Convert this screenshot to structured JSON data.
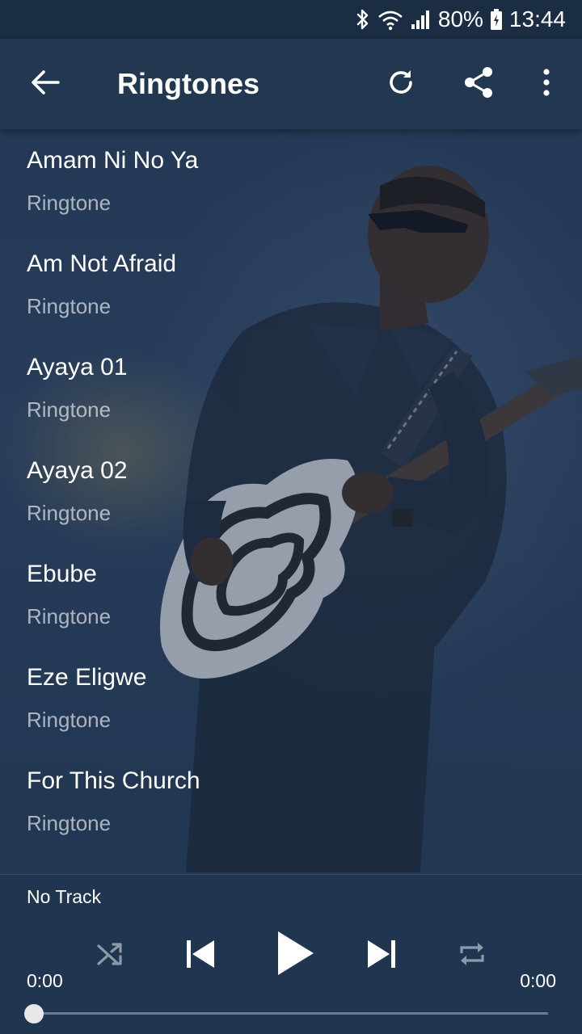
{
  "status_bar": {
    "battery_percent": "80%",
    "time": "13:44",
    "icons": [
      "bluetooth-icon",
      "wifi-icon",
      "signal-icon",
      "battery-charging-icon"
    ]
  },
  "toolbar": {
    "title": "Ringtones",
    "icons": [
      "arrow-back-icon",
      "refresh-icon",
      "share-icon",
      "more-vert-icon"
    ]
  },
  "list": {
    "items": [
      {
        "title": "Amam Ni No Ya",
        "subtitle": "Ringtone"
      },
      {
        "title": "Am Not Afraid",
        "subtitle": "Ringtone"
      },
      {
        "title": "Ayaya 01",
        "subtitle": "Ringtone"
      },
      {
        "title": "Ayaya 02",
        "subtitle": "Ringtone"
      },
      {
        "title": "Ebube",
        "subtitle": "Ringtone"
      },
      {
        "title": "Eze Eligwe",
        "subtitle": "Ringtone"
      },
      {
        "title": "For This Church",
        "subtitle": "Ringtone"
      }
    ]
  },
  "player": {
    "track_title": "No Track",
    "current_time": "0:00",
    "total_time": "0:00",
    "progress": 0,
    "icons": [
      "shuffle-icon",
      "skip-previous-icon",
      "play-icon",
      "skip-next-icon",
      "repeat-icon"
    ]
  },
  "colors": {
    "toolbar": "#223851",
    "status_bar": "#1b2d42",
    "player": "#1f3550",
    "text": "#ffffff"
  }
}
